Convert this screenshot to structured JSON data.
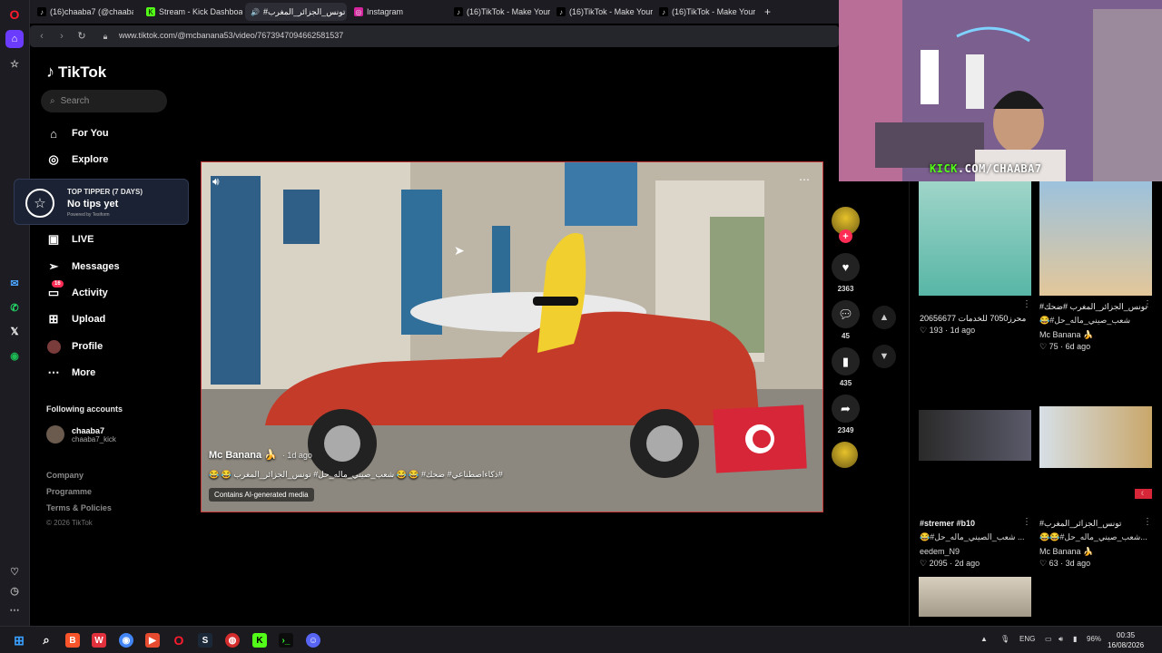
{
  "browser": {
    "tabs": [
      {
        "title": "(16)chaaba7 (@chaaba7_k"
      },
      {
        "title": "Stream - Kick Dashboard"
      },
      {
        "title": "#تونس_الجزائر_المغرب"
      },
      {
        "title": "Instagram"
      },
      {
        "title": "(16)TikTok - Make Your Da"
      },
      {
        "title": "(16)TikTok - Make Your Da"
      },
      {
        "title": "(16)TikTok - Make Your Da"
      }
    ],
    "url": "www.tiktok.com/@mcbanana53/video/7673947094662581537"
  },
  "tiktok": {
    "logo_text": "TikTok",
    "search_placeholder": "Search",
    "nav": [
      {
        "label": "For You",
        "icon": "home-icon"
      },
      {
        "label": "Explore",
        "icon": "compass-icon"
      },
      {
        "label": "LIVE",
        "icon": "live-icon"
      },
      {
        "label": "Messages",
        "icon": "send-icon"
      },
      {
        "label": "Activity",
        "icon": "inbox-icon",
        "badge": "16"
      },
      {
        "label": "Upload",
        "icon": "plus-square-icon"
      },
      {
        "label": "Profile",
        "icon": "avatar"
      },
      {
        "label": "More",
        "icon": "dots-icon"
      }
    ],
    "tipper": {
      "title": "TOP TIPPER (7 DAYS)",
      "value": "No tips yet",
      "powered": "Powered by Tesiform"
    },
    "following_header": "Following accounts",
    "following": [
      {
        "name": "chaaba7",
        "handle": "chaaba7_kick"
      }
    ],
    "footer_links": [
      "Company",
      "Programme",
      "Terms & Policies"
    ],
    "copyright": "© 2026 TikTok"
  },
  "video": {
    "author": "Mc Banana 🍌",
    "ago": "· 1d ago",
    "caption": "😂 😂 ذكاءاصطناعي# ضحك# 😂 😂 شعب_صيني_ماله_حل# تونس_الجزائر_المغرب#",
    "ai_label": "Contains AI-generated media"
  },
  "actions": {
    "likes": "2363",
    "comments": "45",
    "saves": "435",
    "shares": "2349"
  },
  "webcam": {
    "label_k": "KICK",
    "label_rest": ".COM/CHAABA7"
  },
  "grid": [
    {
      "title": "محرز7050 للخدمات 20656677",
      "likes": "♡ 193",
      "ago": "1d ago"
    },
    {
      "title": "#تونس_الجزائر_المغرب #ضحك",
      "sub": "😂#شعب_صيني_ماله_حل",
      "author": "Mc Banana 🍌",
      "likes": "♡ 75",
      "ago": "6d ago"
    },
    {
      "title": "#stremer #b10",
      "sub": "😂#شعب_الصيني_ماله_حل ...",
      "author": "eedem_N9",
      "likes": "♡ 2095",
      "ago": "2d ago"
    },
    {
      "title": "#تونس_الجزائر_المغرب",
      "sub": "😂😂#شعب_صيني_ماله_حل...",
      "author": "Mc Banana 🍌",
      "likes": "♡ 63",
      "ago": "3d ago"
    }
  ],
  "taskbar": {
    "lang": "ENG",
    "battery": "96%",
    "time": "00:35",
    "date": "16/08/2026"
  },
  "colors": {
    "tiktok_pink": "#fe2c55",
    "kick_green": "#53fc18",
    "video_border": "#c83a3a"
  }
}
